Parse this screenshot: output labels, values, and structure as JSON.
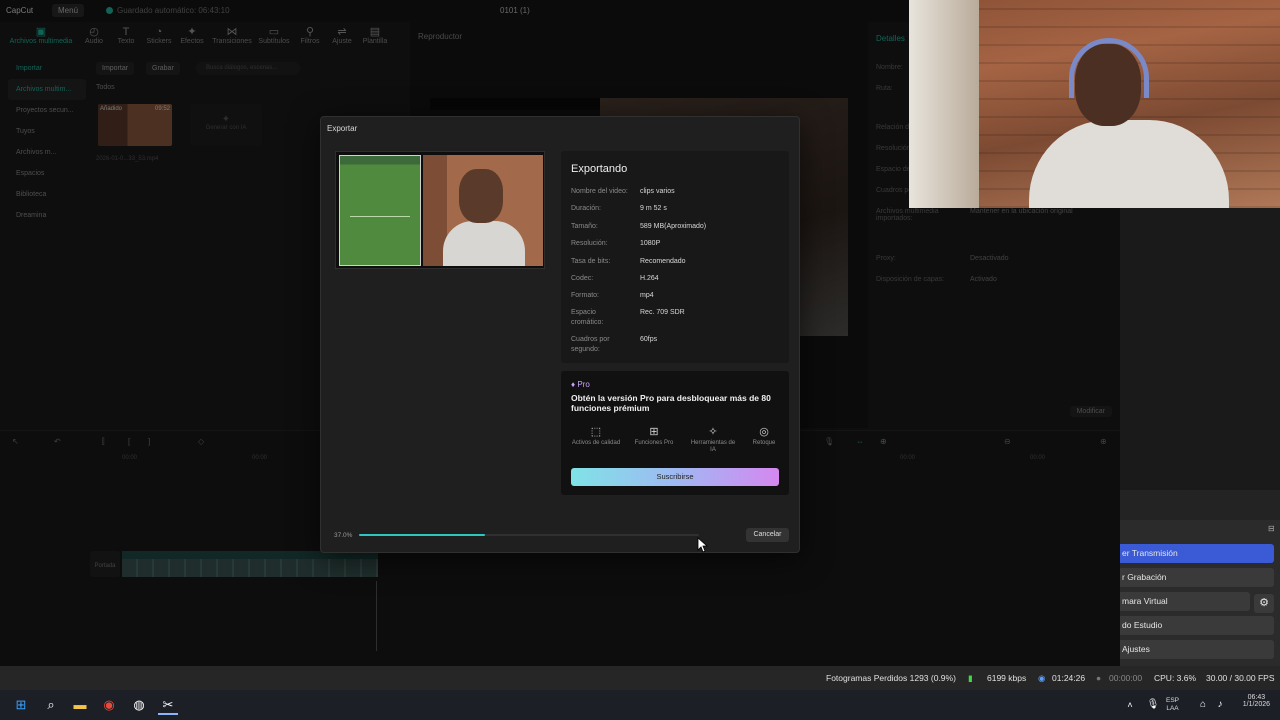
{
  "capcut": {
    "logo": "CapCut",
    "menu": "Menú",
    "autosave": "Guardado automático: 06:43:10",
    "project_title": "0101 (1)",
    "tools": [
      {
        "label": "Archivos multimedia",
        "icon": "media-icon"
      },
      {
        "label": "Audio",
        "icon": "audio-icon"
      },
      {
        "label": "Texto",
        "icon": "text-icon"
      },
      {
        "label": "Stickers",
        "icon": "sticker-icon"
      },
      {
        "label": "Efectos",
        "icon": "effects-icon"
      },
      {
        "label": "Transiciones",
        "icon": "transitions-icon"
      },
      {
        "label": "Subtítulos",
        "icon": "subtitles-icon"
      },
      {
        "label": "Filtros",
        "icon": "filters-icon"
      },
      {
        "label": "Ajuste",
        "icon": "adjust-icon"
      },
      {
        "label": "Plantilla",
        "icon": "template-icon"
      }
    ],
    "left_nav": [
      "Importar",
      "Archivos multim...",
      "Proyectos secun...",
      "Tuyos",
      "Archivos m...",
      "Espacios",
      "Biblioteca",
      "Dreamina"
    ],
    "media": {
      "import_label": "Importar",
      "record_label": "Grabar",
      "search_placeholder": "Busca diálogos, escenas...",
      "all_label": "Todos",
      "added_label": "Añadido",
      "thumb_duration": "09:52",
      "thumb_name": "2026-01-0...33_53.mp4",
      "ai_card": "Generar con IA"
    },
    "player_title": "Reproductor",
    "details": {
      "title": "Detalles",
      "rows": [
        {
          "k": "Nombre:",
          "v": ""
        },
        {
          "k": "Ruta:",
          "v": ""
        },
        {
          "k": "Relación de aspecto:",
          "v": ""
        },
        {
          "k": "Resolución:",
          "v": ""
        },
        {
          "k": "Espacio de color:",
          "v": ""
        },
        {
          "k": "Cuadros por segundo:",
          "v": ""
        },
        {
          "k": "Archivos multimedia importados:",
          "v": "Mantener en la ubicación original"
        },
        {
          "k": "Proxy:",
          "v": "Desactivado"
        },
        {
          "k": "Disposición de capas:",
          "v": "Activado"
        }
      ],
      "modify": "Modificar"
    },
    "timeline": {
      "ruler": [
        "00:00",
        "00:00",
        "00:00",
        "00:00"
      ],
      "cover": "Portada"
    }
  },
  "export_dialog": {
    "title": "Exportar",
    "heading": "Exportando",
    "rows": [
      {
        "k": "Nombre del video:",
        "v": "clips varios"
      },
      {
        "k": "Duración:",
        "v": "9 m 52 s"
      },
      {
        "k": "Tamaño:",
        "v": "589 MB(Aproximado)"
      },
      {
        "k": "Resolución:",
        "v": "1080P"
      },
      {
        "k": "Tasa de bits:",
        "v": "Recomendado"
      },
      {
        "k": "Codec:",
        "v": "H.264"
      },
      {
        "k": "Formato:",
        "v": "mp4"
      },
      {
        "k": "Espacio cromático:",
        "v": "Rec. 709 SDR"
      },
      {
        "k": "Cuadros por segundo:",
        "v": "60fps"
      }
    ],
    "pro": {
      "badge": "Pro",
      "message": "Obtén la versión Pro para desbloquear más de 80 funciones prémium",
      "features": [
        {
          "label": "Activos de calidad",
          "icon": "quality-assets-icon",
          "glyph": "⬚"
        },
        {
          "label": "Funciones Pro",
          "icon": "pro-functions-icon",
          "glyph": "⊞"
        },
        {
          "label": "Herramientas de IA",
          "icon": "ai-tools-icon",
          "glyph": "✧"
        },
        {
          "label": "Retoque",
          "icon": "retouch-icon",
          "glyph": "◎"
        }
      ],
      "subscribe": "Suscribirse"
    },
    "progress_label": "37.0%",
    "progress": 0.37,
    "cancel": "Cancelar"
  },
  "obs": {
    "buttons": [
      {
        "label": "er Transmisión",
        "active": true
      },
      {
        "label": "r Grabación",
        "active": false
      },
      {
        "label": "mara Virtual",
        "active": false
      },
      {
        "label": "do Estudio",
        "active": false
      },
      {
        "label": "Ajustes",
        "active": false
      }
    ],
    "status": {
      "dropped": "Fotogramas Perdidos 1293 (0.9%)",
      "kbps": "6199 kbps",
      "stream_time": "01:24:26",
      "rec_time": "00:00:00",
      "cpu": "CPU: 3.6%",
      "fps": "30.00 / 30.00 FPS"
    }
  },
  "taskbar": {
    "lang_top": "ESP",
    "lang_bottom": "LAA",
    "time": "06:43",
    "date": "1/1/2026"
  },
  "colors": {
    "accent": "#1fb59b",
    "obs_active": "#3a5ad6",
    "progress": "#2fc6c0"
  }
}
